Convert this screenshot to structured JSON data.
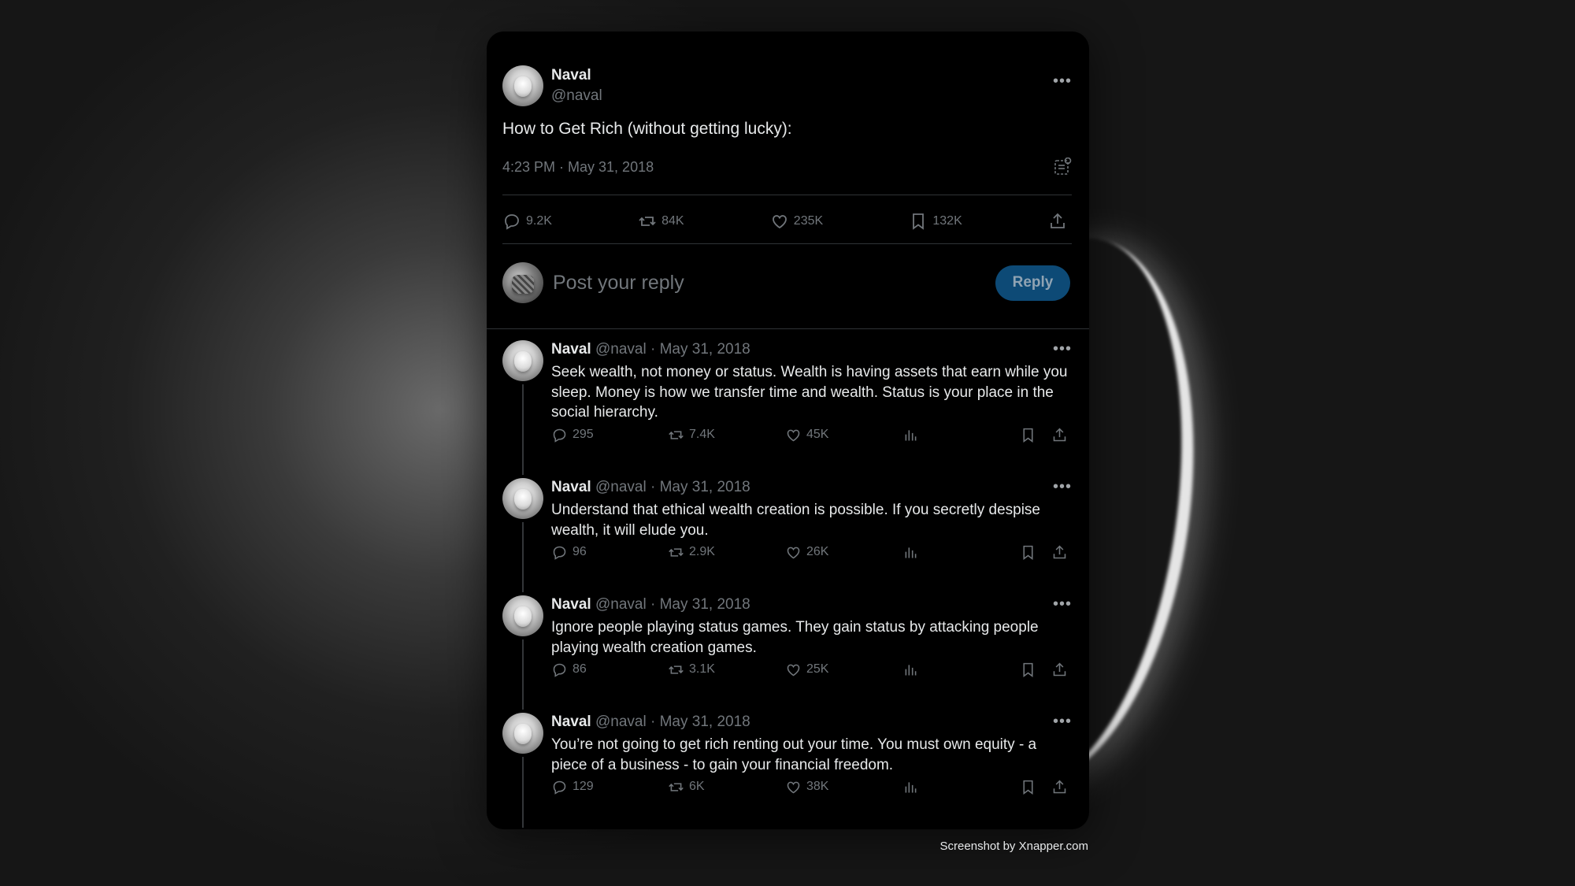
{
  "main": {
    "author_name": "Naval",
    "author_handle": "@naval",
    "text": "How to Get Rich (without getting lucky):",
    "timestamp": "4:23 PM · May 31, 2018",
    "replies": "9.2K",
    "reposts": "84K",
    "likes": "235K",
    "bookmarks": "132K"
  },
  "reply_box": {
    "placeholder": "Post your reply",
    "button_label": "Reply"
  },
  "thread": [
    {
      "name": "Naval",
      "handle": "@naval",
      "date": "May 31, 2018",
      "text": "Seek wealth, not money or status. Wealth is having assets that earn while you sleep. Money is how we transfer time and wealth. Status is your place in the social hierarchy.",
      "replies": "295",
      "reposts": "7.4K",
      "likes": "45K"
    },
    {
      "name": "Naval",
      "handle": "@naval",
      "date": "May 31, 2018",
      "text": "Understand that ethical wealth creation is possible. If you secretly despise wealth, it will elude you.",
      "replies": "96",
      "reposts": "2.9K",
      "likes": "26K"
    },
    {
      "name": "Naval",
      "handle": "@naval",
      "date": "May 31, 2018",
      "text": "Ignore people playing status games. They gain status by attacking people playing wealth creation games.",
      "replies": "86",
      "reposts": "3.1K",
      "likes": "25K"
    },
    {
      "name": "Naval",
      "handle": "@naval",
      "date": "May 31, 2018",
      "text": "You’re not going to get rich renting out your time. You must own equity - a piece of a business - to gain your financial freedom.",
      "replies": "129",
      "reposts": "6K",
      "likes": "38K"
    }
  ],
  "dot": "·",
  "footer": "Screenshot by Xnapper.com",
  "colors": {
    "background": "#000000",
    "text_primary": "#e7e9ea",
    "text_secondary": "#71767b",
    "reply_button": "#0d4a76",
    "divider": "#2f3336"
  },
  "icons": [
    "more-icon",
    "analytics-icon",
    "reply-icon",
    "repost-icon",
    "like-icon",
    "bookmark-icon",
    "share-icon",
    "views-icon"
  ]
}
